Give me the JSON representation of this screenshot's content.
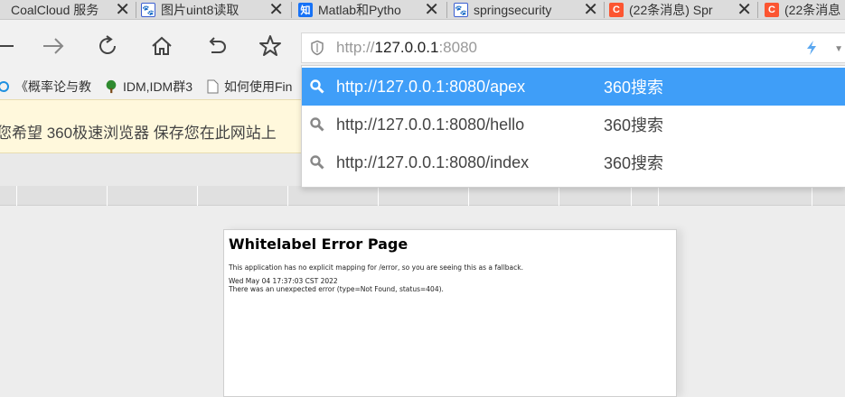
{
  "tabs": [
    {
      "title": "CoalCloud 服务",
      "icon": "cloud-icon"
    },
    {
      "title": "图片uint8读取",
      "icon": "baidu-paw-icon"
    },
    {
      "title": "Matlab和Pytho",
      "icon": "zhihu-icon",
      "icon_text": "知"
    },
    {
      "title": "springsecurity",
      "icon": "baidu-paw-icon"
    },
    {
      "title": "(22条消息) Spr",
      "icon": "csdn-icon",
      "icon_text": "C"
    },
    {
      "title": "(22条消息",
      "icon": "csdn-icon",
      "icon_text": "C"
    }
  ],
  "address": {
    "prefix": "http://",
    "host": "127.0.0.1",
    "port": ":8080"
  },
  "bookmarks": [
    {
      "label": "《概率论与教",
      "icon": "ie-icon"
    },
    {
      "label": "IDM,IDM群3",
      "icon": "tree-icon"
    },
    {
      "label": "如何使用Fin",
      "icon": "page-icon"
    }
  ],
  "notice": {
    "text": "您希望 360极速浏览器 保存您在此网站上"
  },
  "suggestions": [
    {
      "url": "http://127.0.0.1:8080/apex",
      "engine": "360搜索",
      "active": true
    },
    {
      "url": "http://127.0.0.1:8080/hello",
      "engine": "360搜索",
      "active": false
    },
    {
      "url": "http://127.0.0.1:8080/index",
      "engine": "360搜索",
      "active": false
    }
  ],
  "page": {
    "title": "Whitelabel Error Page",
    "message": "This application has no explicit mapping for /error, so you are seeing this as a fallback.",
    "timestamp": "Wed May 04 17:37:03 CST 2022",
    "error": "There was an unexpected error (type=Not Found, status=404)."
  },
  "colors": {
    "highlight": "#3f9ef8",
    "notice_bg": "#fff8dc"
  }
}
